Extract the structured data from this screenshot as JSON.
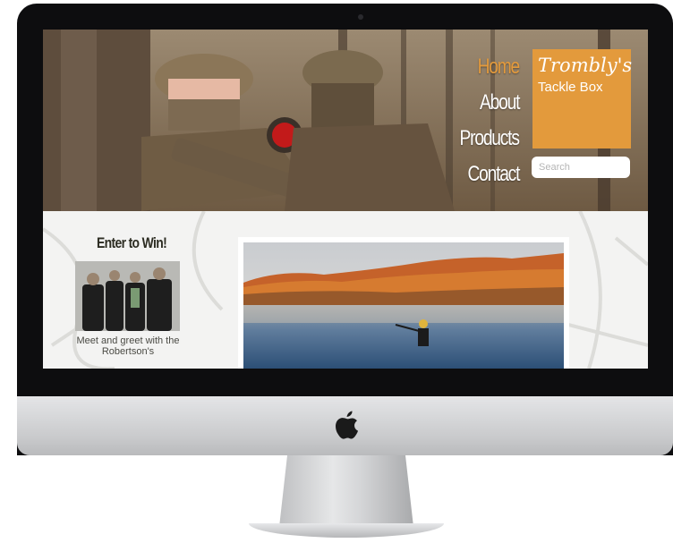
{
  "site": {
    "nav": [
      "Home",
      "About",
      "Products",
      "Contact"
    ],
    "active_nav": "Home",
    "logo": {
      "title": "Trombly's",
      "subtitle": "Tackle Box"
    },
    "search": {
      "placeholder": "Search"
    },
    "promo": {
      "title": "Enter to Win!",
      "caption": "Meet and greet with the Robertson's"
    }
  },
  "colors": {
    "accent": "#e39a3c",
    "bezel": "#0d0d0f",
    "nav_text": "#ffffff"
  },
  "icons": [
    "apple-logo-icon"
  ]
}
